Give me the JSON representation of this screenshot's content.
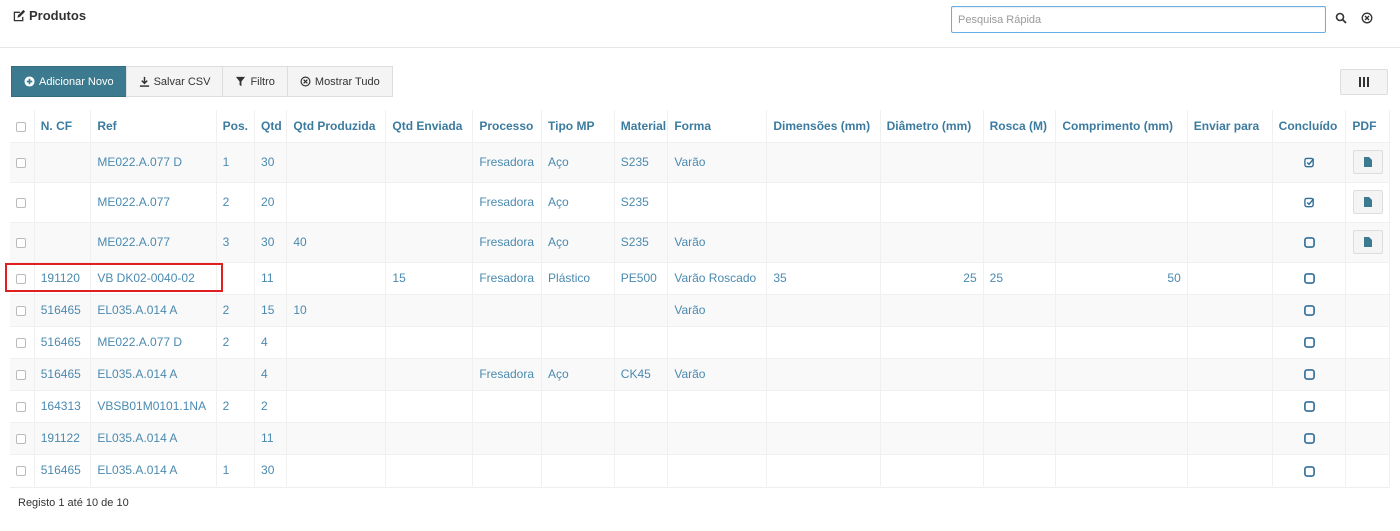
{
  "header": {
    "title": "Produtos",
    "search_placeholder": "Pesquisa Rápida"
  },
  "toolbar": {
    "add_new": "Adicionar Novo",
    "save_csv": "Salvar CSV",
    "filter": "Filtro",
    "show_all": "Mostrar Tudo"
  },
  "table": {
    "columns": [
      "N. CF",
      "Ref",
      "Pos.",
      "Qtd",
      "Qtd Produzida",
      "Qtd Enviada",
      "Processo",
      "Tipo MP",
      "Material",
      "Forma",
      "Dimensões (mm)",
      "Diâmetro (mm)",
      "Rosca (M)",
      "Comprimento (mm)",
      "Enviar para",
      "Concluído",
      "PDF"
    ],
    "rows": [
      {
        "ncf": "",
        "ref": "ME022.A.077 D",
        "pos": "1",
        "qtd": "30",
        "qtd_produzida": "",
        "qtd_enviada": "",
        "processo": "Fresadora",
        "tipo_mp": "Aço",
        "material": "S235",
        "forma": "Varão",
        "dimensoes": "",
        "diametro": "",
        "rosca": "",
        "comprimento": "",
        "enviar_para": "",
        "concluido": "checked",
        "pdf": "pdf"
      },
      {
        "ncf": "",
        "ref": "ME022.A.077",
        "pos": "2",
        "qtd": "20",
        "qtd_produzida": "",
        "qtd_enviada": "",
        "processo": "Fresadora",
        "tipo_mp": "Aço",
        "material": "S235",
        "forma": "",
        "dimensoes": "",
        "diametro": "",
        "rosca": "",
        "comprimento": "",
        "enviar_para": "",
        "concluido": "checked",
        "pdf": "pdf"
      },
      {
        "ncf": "",
        "ref": "ME022.A.077",
        "pos": "3",
        "qtd": "30",
        "qtd_produzida": "40",
        "qtd_enviada": "",
        "processo": "Fresadora",
        "tipo_mp": "Aço",
        "material": "S235",
        "forma": "Varão",
        "dimensoes": "",
        "diametro": "",
        "rosca": "",
        "comprimento": "",
        "enviar_para": "",
        "concluido": "unchecked",
        "pdf": "pdf"
      },
      {
        "ncf": "191120",
        "ref": "VB DK02-0040-02",
        "pos": "",
        "qtd": "11",
        "qtd_produzida": "",
        "qtd_enviada": "15",
        "processo": "Fresadora",
        "tipo_mp": "Plástico",
        "material": "PE500",
        "forma": "Varão Roscado",
        "dimensoes": "35",
        "diametro": "25",
        "rosca": "25",
        "comprimento": "50",
        "enviar_para": "",
        "concluido": "unchecked",
        "pdf": ""
      },
      {
        "ncf": "516465",
        "ref": "EL035.A.014 A",
        "pos": "2",
        "qtd": "15",
        "qtd_produzida": "10",
        "qtd_enviada": "",
        "processo": "",
        "tipo_mp": "",
        "material": "",
        "forma": "Varão",
        "dimensoes": "",
        "diametro": "",
        "rosca": "",
        "comprimento": "",
        "enviar_para": "",
        "concluido": "unchecked",
        "pdf": ""
      },
      {
        "ncf": "516465",
        "ref": "ME022.A.077 D",
        "pos": "2",
        "qtd": "4",
        "qtd_produzida": "",
        "qtd_enviada": "",
        "processo": "",
        "tipo_mp": "",
        "material": "",
        "forma": "",
        "dimensoes": "",
        "diametro": "",
        "rosca": "",
        "comprimento": "",
        "enviar_para": "",
        "concluido": "unchecked",
        "pdf": ""
      },
      {
        "ncf": "516465",
        "ref": "EL035.A.014 A",
        "pos": "",
        "qtd": "4",
        "qtd_produzida": "",
        "qtd_enviada": "",
        "processo": "Fresadora",
        "tipo_mp": "Aço",
        "material": "CK45",
        "forma": "Varão",
        "dimensoes": "",
        "diametro": "",
        "rosca": "",
        "comprimento": "",
        "enviar_para": "",
        "concluido": "unchecked",
        "pdf": ""
      },
      {
        "ncf": "164313",
        "ref": "VBSB01M0101.1NA",
        "pos": "2",
        "qtd": "2",
        "qtd_produzida": "",
        "qtd_enviada": "",
        "processo": "",
        "tipo_mp": "",
        "material": "",
        "forma": "",
        "dimensoes": "",
        "diametro": "",
        "rosca": "",
        "comprimento": "",
        "enviar_para": "",
        "concluido": "unchecked",
        "pdf": ""
      },
      {
        "ncf": "191122",
        "ref": "EL035.A.014 A",
        "pos": "",
        "qtd": "11",
        "qtd_produzida": "",
        "qtd_enviada": "",
        "processo": "",
        "tipo_mp": "",
        "material": "",
        "forma": "",
        "dimensoes": "",
        "diametro": "",
        "rosca": "",
        "comprimento": "",
        "enviar_para": "",
        "concluido": "unchecked",
        "pdf": ""
      },
      {
        "ncf": "516465",
        "ref": "EL035.A.014 A",
        "pos": "1",
        "qtd": "30",
        "qtd_produzida": "",
        "qtd_enviada": "",
        "processo": "",
        "tipo_mp": "",
        "material": "",
        "forma": "",
        "dimensoes": "",
        "diametro": "",
        "rosca": "",
        "comprimento": "",
        "enviar_para": "",
        "concluido": "unchecked",
        "pdf": ""
      }
    ]
  },
  "footer": {
    "pagination_text": "Registo 1 até 10 de 10"
  },
  "colors": {
    "accent": "#3c7b8f",
    "link": "#4a8ab0",
    "highlight": "#e02020"
  }
}
